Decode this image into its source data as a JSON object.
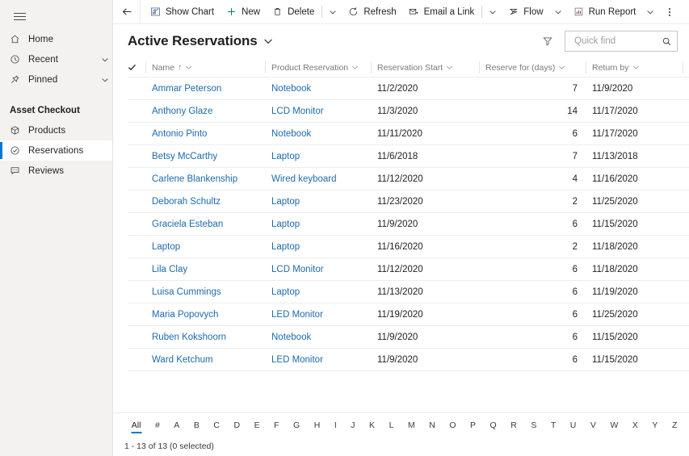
{
  "sidebar": {
    "menu_icon": "hamburger-icon",
    "top_items": [
      {
        "label": "Home",
        "icon": "home-icon",
        "chevron": false
      },
      {
        "label": "Recent",
        "icon": "clock-icon",
        "chevron": true
      },
      {
        "label": "Pinned",
        "icon": "pin-icon",
        "chevron": true
      }
    ],
    "group_title": "Asset Checkout",
    "group_items": [
      {
        "label": "Products",
        "icon": "box-icon",
        "selected": false
      },
      {
        "label": "Reservations",
        "icon": "check-circle-icon",
        "selected": true
      },
      {
        "label": "Reviews",
        "icon": "comment-icon",
        "selected": false
      }
    ]
  },
  "commandbar": {
    "back_icon": "back-arrow-icon",
    "buttons": [
      {
        "label": "Show Chart",
        "icon": "chart-icon",
        "caret": false
      },
      {
        "label": "New",
        "icon": "plus-icon",
        "caret": false
      },
      {
        "label": "Delete",
        "icon": "trash-icon",
        "caret": false
      },
      {
        "label": "Refresh",
        "icon": "refresh-icon",
        "caret": false
      },
      {
        "label": "Email a Link",
        "icon": "email-icon",
        "caret": false
      },
      {
        "label": "Flow",
        "icon": "flow-icon",
        "caret": true
      },
      {
        "label": "Run Report",
        "icon": "report-icon",
        "caret": true
      }
    ],
    "overflow_icon": "more-vertical-icon"
  },
  "view": {
    "title": "Active Reservations",
    "title_caret_icon": "chevron-down-icon",
    "filter_icon": "filter-icon",
    "search": {
      "placeholder": "Quick find",
      "value": "",
      "icon": "search-icon"
    }
  },
  "grid": {
    "select_all_icon": "checkmark-icon",
    "columns": [
      {
        "label": "Name",
        "sorted": true,
        "sort_icon": "sort-asc-icon",
        "align": "left"
      },
      {
        "label": "Product Reservation",
        "sorted": false,
        "align": "left"
      },
      {
        "label": "Reservation Start",
        "sorted": false,
        "align": "left"
      },
      {
        "label": "Reserve for (days)",
        "sorted": false,
        "align": "right"
      },
      {
        "label": "Return by",
        "sorted": false,
        "align": "left"
      }
    ],
    "rows": [
      {
        "name": "Ammar Peterson",
        "product": "Notebook",
        "start": "11/2/2020",
        "days": "7",
        "return": "11/9/2020"
      },
      {
        "name": "Anthony Glaze",
        "product": "LCD Monitor",
        "start": "11/3/2020",
        "days": "14",
        "return": "11/17/2020"
      },
      {
        "name": "Antonio Pinto",
        "product": "Notebook",
        "start": "11/11/2020",
        "days": "6",
        "return": "11/17/2020"
      },
      {
        "name": "Betsy McCarthy",
        "product": "Laptop",
        "start": "11/6/2018",
        "days": "7",
        "return": "11/13/2018"
      },
      {
        "name": "Carlene Blankenship",
        "product": "Wired keyboard",
        "start": "11/12/2020",
        "days": "4",
        "return": "11/16/2020"
      },
      {
        "name": "Deborah Schultz",
        "product": "Laptop",
        "start": "11/23/2020",
        "days": "2",
        "return": "11/25/2020"
      },
      {
        "name": "Graciela Esteban",
        "product": "Laptop",
        "start": "11/9/2020",
        "days": "6",
        "return": "11/15/2020"
      },
      {
        "name": "Laptop",
        "product": "Laptop",
        "start": "11/16/2020",
        "days": "2",
        "return": "11/18/2020"
      },
      {
        "name": "Lila Clay",
        "product": "LCD Monitor",
        "start": "11/12/2020",
        "days": "6",
        "return": "11/18/2020"
      },
      {
        "name": "Luisa Cummings",
        "product": "Laptop",
        "start": "11/13/2020",
        "days": "6",
        "return": "11/19/2020"
      },
      {
        "name": "Maria Popovych",
        "product": "LED Monitor",
        "start": "11/19/2020",
        "days": "6",
        "return": "11/25/2020"
      },
      {
        "name": "Ruben Kokshoorn",
        "product": "Notebook",
        "start": "11/9/2020",
        "days": "6",
        "return": "11/15/2020"
      },
      {
        "name": "Ward Ketchum",
        "product": "LED Monitor",
        "start": "11/9/2020",
        "days": "6",
        "return": "11/15/2020"
      }
    ]
  },
  "alphabet": {
    "items": [
      "All",
      "#",
      "A",
      "B",
      "C",
      "D",
      "E",
      "F",
      "G",
      "H",
      "I",
      "J",
      "K",
      "L",
      "M",
      "N",
      "O",
      "P",
      "Q",
      "R",
      "S",
      "T",
      "U",
      "V",
      "W",
      "X",
      "Y",
      "Z"
    ],
    "active": "All"
  },
  "status": {
    "text": "1 - 13 of 13 (0 selected)"
  },
  "colors": {
    "accent": "#0078d4",
    "link": "#1d6bae",
    "sidebar_bg": "#f3f2f1",
    "text": "#201f1e",
    "muted": "#7a7876",
    "new_green": "#107c41"
  }
}
